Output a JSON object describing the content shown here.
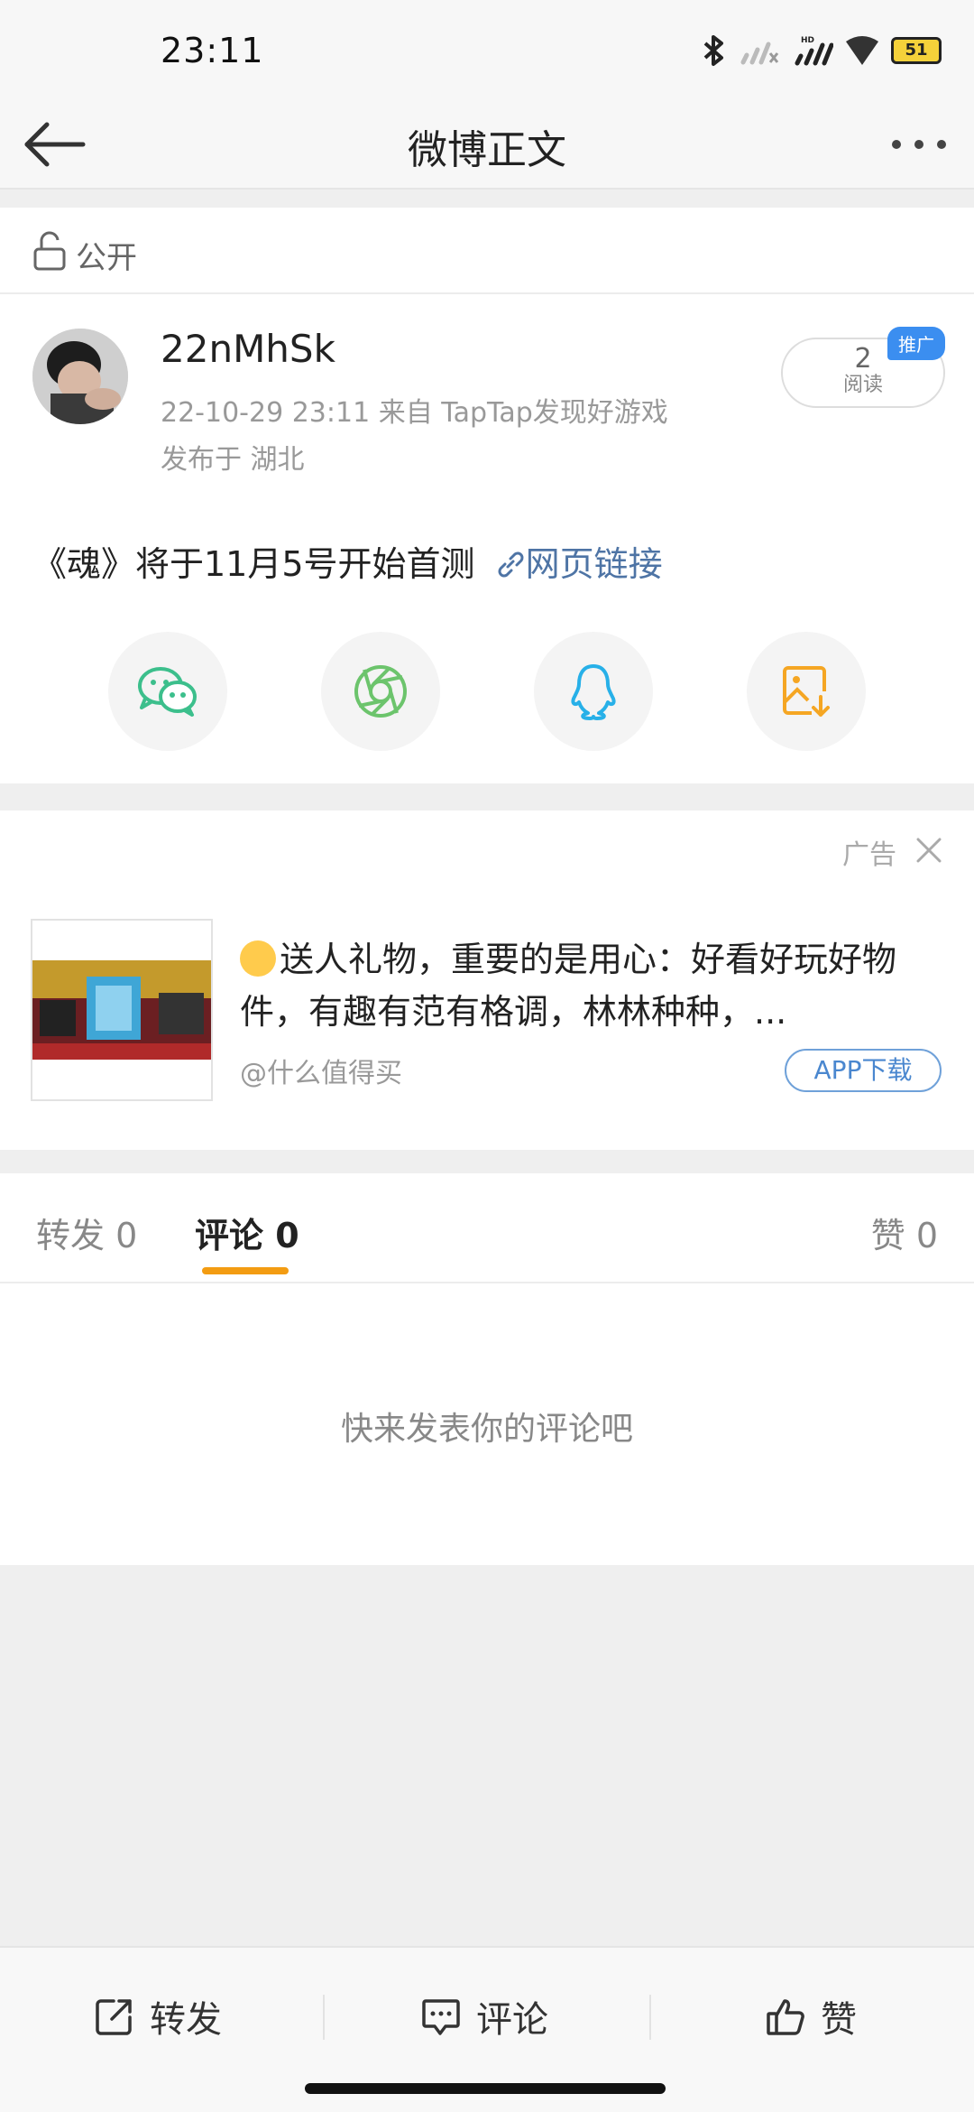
{
  "status_bar": {
    "time": "23:11",
    "battery": "51",
    "network_badge": "HD"
  },
  "nav": {
    "title": "微博正文",
    "back_icon": "arrow-left-icon",
    "more_icon": "ellipsis-icon"
  },
  "post": {
    "visibility": "公开",
    "username": "22nMhSk",
    "meta": "22-10-29 23:11   来自 TapTap发现好游戏",
    "location": "发布于 湖北",
    "read_count": "2",
    "read_label": "阅读",
    "promo_badge": "推广",
    "text": "《魂》将于11月5号开始首测",
    "link_label": "网页链接"
  },
  "share_icons": [
    "wechat-icon",
    "moments-icon",
    "qq-icon",
    "save-image-icon"
  ],
  "ad": {
    "label": "广告",
    "title": "送人礼物，重要的是用心：好看好玩好物件，有趣有范有格调，林林种种，...",
    "source": "@什么值得买",
    "button": "APP下载"
  },
  "tabs": {
    "repost": "转发 0",
    "comment": "评论 0",
    "like": "赞 0"
  },
  "comments_empty": "快来发表你的评论吧",
  "bottom_bar": {
    "repost": "转发",
    "comment": "评论",
    "like": "赞"
  },
  "colors": {
    "accent": "#f39c12",
    "link": "#4e74a5",
    "promo": "#3b8ef0"
  }
}
